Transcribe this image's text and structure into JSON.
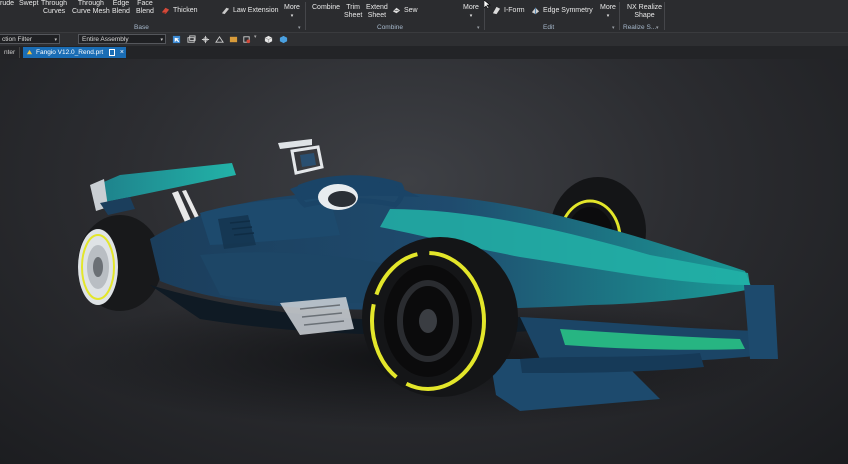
{
  "ribbon": {
    "surface_buttons": [
      {
        "lines": [
          "rude"
        ]
      },
      {
        "lines": [
          "Swept"
        ]
      },
      {
        "lines": [
          "Through",
          "Curves"
        ]
      },
      {
        "lines": [
          "Through",
          "Curve Mesh"
        ]
      },
      {
        "lines": [
          "Edge",
          "Blend"
        ]
      },
      {
        "lines": [
          "Face",
          "Blend"
        ]
      }
    ],
    "thicken": "Thicken",
    "law_extension": "Law Extension",
    "more_1": "More",
    "base_group": "Base",
    "combine": "Combine",
    "trim_sheet": [
      "Trim",
      "Sheet"
    ],
    "extend_sheet": [
      "Extend",
      "Sheet"
    ],
    "sew": "Sew",
    "combine_group": "Combine",
    "more_2": "More",
    "i_form": "I-Form",
    "edge_symmetry": "Edge Symmetry",
    "more_3": "More",
    "edit_group": "Edit",
    "nx_realize": [
      "NX Realize",
      "Shape"
    ],
    "realize_group": "Realize S..."
  },
  "selection_bar": {
    "filter": "ction Filter",
    "scope": "Entire Assembly"
  },
  "tabs": {
    "previous": "nter",
    "active": "Fangio V12.0_Rend.prt"
  },
  "colors": {
    "ribbon_bg": "#2b2c2f",
    "tab_active": "#1a6db5",
    "car_teal": "#1fa6a0",
    "car_navy": "#1f4b6e",
    "tyre_stripe": "#e3e62a"
  },
  "icons": {
    "thicken": "thicken-icon",
    "law_extension": "law-extension-icon",
    "sew": "sew-icon",
    "i_form": "i-form-icon",
    "edge_symmetry": "edge-symmetry-icon"
  }
}
